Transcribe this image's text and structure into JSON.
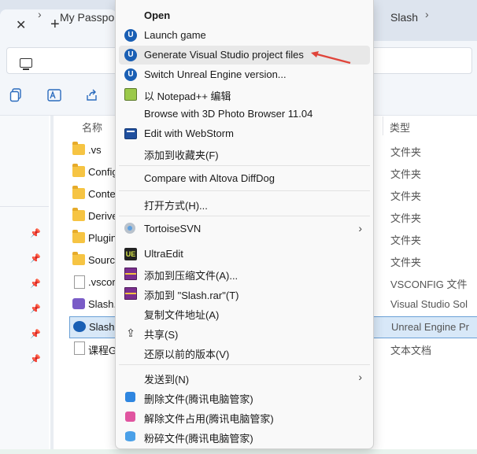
{
  "explorer": {
    "tab_close": "✕",
    "tab_new": "+",
    "breadcrumb": {
      "separator": "›",
      "items": [
        "My Passpor",
        "Slash"
      ]
    },
    "toolbar_icons": [
      "copy-icon",
      "rename-icon",
      "share-icon"
    ],
    "columns": {
      "name": "名称",
      "type": "类型"
    },
    "files": [
      {
        "name": ".vs",
        "type": "文件夹",
        "icon": "folder-icon"
      },
      {
        "name": "Config",
        "type": "文件夹",
        "icon": "folder-icon"
      },
      {
        "name": "Conte",
        "type": "文件夹",
        "icon": "folder-icon"
      },
      {
        "name": "Derive",
        "type": "文件夹",
        "icon": "folder-icon"
      },
      {
        "name": "Plugin",
        "type": "文件夹",
        "icon": "folder-icon"
      },
      {
        "name": "Sourc",
        "type": "文件夹",
        "icon": "folder-icon"
      },
      {
        "name": ".vscor",
        "type": "VSCONFIG 文件",
        "icon": "document-icon"
      },
      {
        "name": "Slash.",
        "type": "Visual Studio Sol",
        "icon": "visual-studio-icon"
      },
      {
        "name": "Slash.",
        "type": "Unreal Engine Pr",
        "icon": "unreal-engine-icon",
        "selected": true
      },
      {
        "name": "课程G",
        "type": "文本文档",
        "icon": "document-icon"
      }
    ]
  },
  "context_menu": {
    "items": [
      {
        "label": "Open",
        "icon": "",
        "bold": true
      },
      {
        "label": "Launch game",
        "icon": "unreal-engine-icon"
      },
      {
        "label": "Generate Visual Studio project files",
        "icon": "unreal-engine-icon",
        "highlighted": true
      },
      {
        "label": "Switch Unreal Engine version...",
        "icon": "unreal-engine-icon"
      },
      {
        "label": "以 Notepad++ 编辑",
        "icon": "notepad-plus-plus-icon"
      },
      {
        "label": "Browse with 3D Photo Browser 11.04",
        "icon": ""
      },
      {
        "label": "Edit with WebStorm",
        "icon": "webstorm-icon"
      },
      {
        "label": "添加到收藏夹(F)",
        "icon": ""
      },
      {
        "label": "Compare with Altova DiffDog",
        "icon": ""
      },
      {
        "label": "打开方式(H)...",
        "icon": ""
      },
      {
        "label": "TortoiseSVN",
        "icon": "tortoise-svn-icon",
        "submenu": true
      },
      {
        "label": "UltraEdit",
        "icon": "ultraedit-icon"
      },
      {
        "label": "添加到压缩文件(A)...",
        "icon": "winrar-icon"
      },
      {
        "label": "添加到 \"Slash.rar\"(T)",
        "icon": "winrar-icon"
      },
      {
        "label": "复制文件地址(A)",
        "icon": ""
      },
      {
        "label": "共享(S)",
        "icon": "share-icon"
      },
      {
        "label": "还原以前的版本(V)",
        "icon": ""
      },
      {
        "label": "发送到(N)",
        "icon": "",
        "submenu": true
      },
      {
        "label": "删除文件(腾讯电脑管家)",
        "icon": "tencent-pc-manager-icon"
      },
      {
        "label": "解除文件占用(腾讯电脑管家)",
        "icon": "tencent-pc-manager-icon"
      },
      {
        "label": "粉碎文件(腾讯电脑管家)",
        "icon": "tencent-pc-manager-icon"
      }
    ],
    "submenu_glyph": "›",
    "ue_glyph": "U",
    "ultraedit_glyph": "UE",
    "share_glyph": "⇪"
  },
  "annotation": {
    "arrow_color": "#e0443a"
  },
  "colors": {
    "selection": "#d8e8f8",
    "selection_border": "#6aa0d6",
    "ue_blue": "#1a5fb4"
  }
}
